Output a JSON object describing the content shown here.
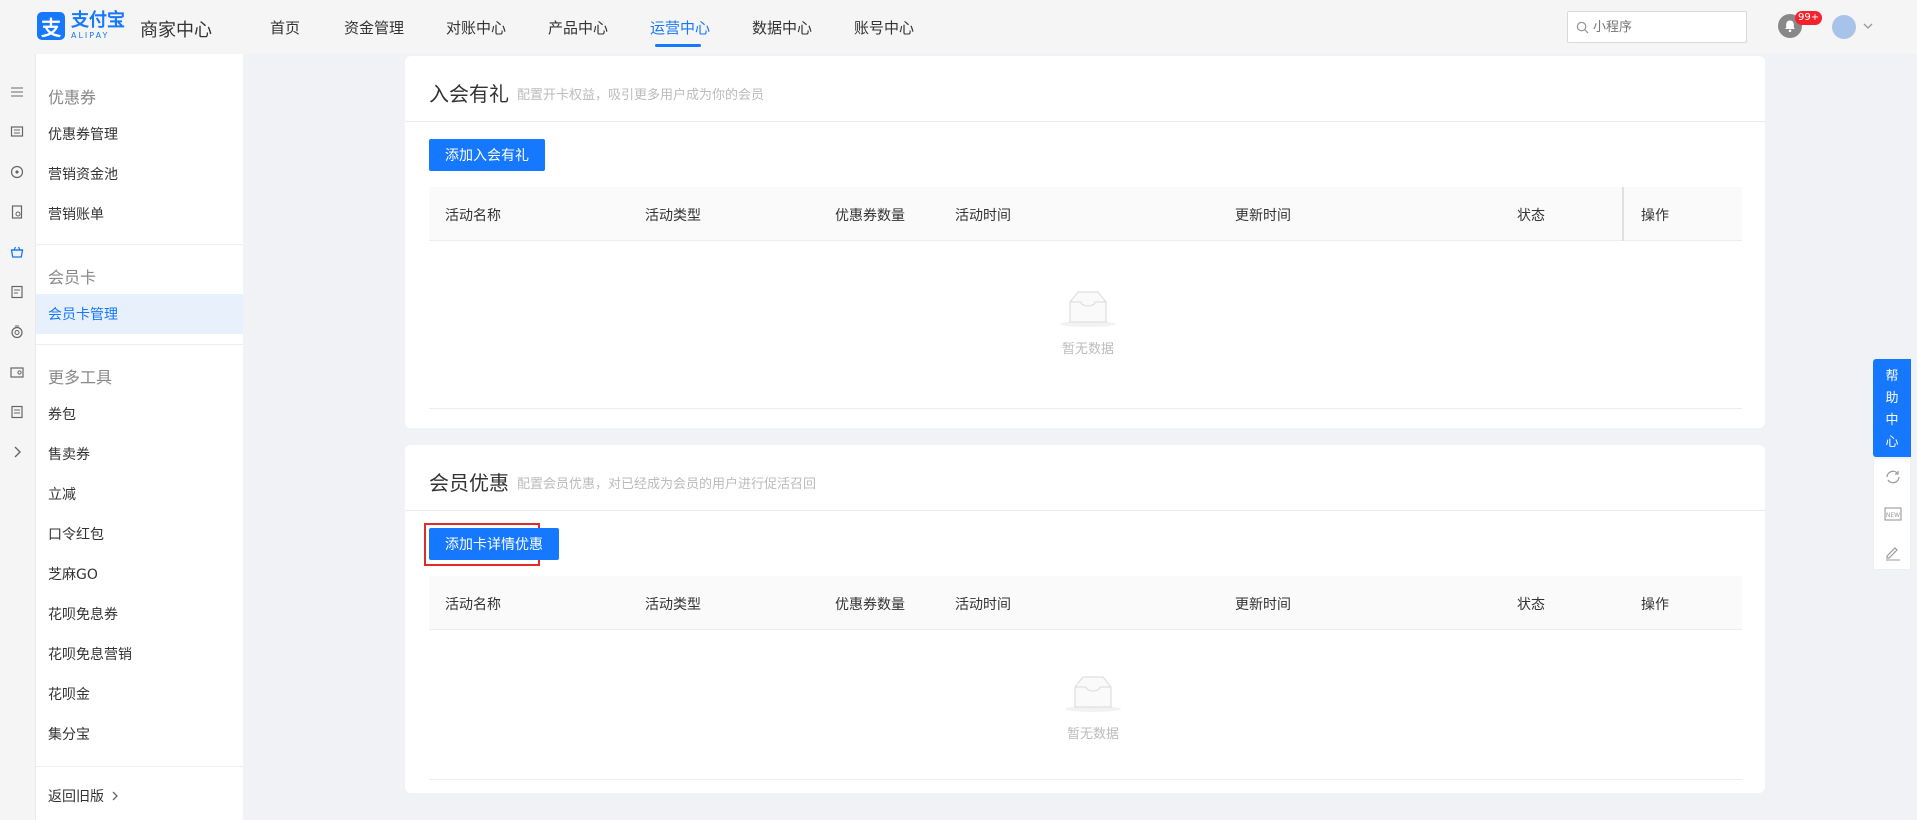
{
  "header": {
    "logo_cn": "支付宝",
    "logo_en": "ALIPAY",
    "logo_mark": "支",
    "brand": "商家中心",
    "nav": [
      {
        "label": "首页"
      },
      {
        "label": "资金管理"
      },
      {
        "label": "对账中心"
      },
      {
        "label": "产品中心"
      },
      {
        "label": "运营中心",
        "active": true
      },
      {
        "label": "数据中心"
      },
      {
        "label": "账号中心"
      }
    ],
    "search_placeholder": "小程序",
    "badge": "99+"
  },
  "sidebar": {
    "groups": [
      {
        "title": "优惠券",
        "items": [
          "优惠券管理",
          "营销资金池",
          "营销账单"
        ]
      },
      {
        "title": "会员卡",
        "items": [
          "会员卡管理"
        ]
      },
      {
        "title": "更多工具",
        "items": [
          "券包",
          "售卖券",
          "立减",
          "口令红包",
          "芝麻GO",
          "花呗免息券",
          "花呗免息营销",
          "花呗金",
          "集分宝"
        ]
      }
    ],
    "active_item": "会员卡管理",
    "back_label": "返回旧版"
  },
  "section1": {
    "title": "入会有礼",
    "desc": "配置开卡权益，吸引更多用户成为你的会员",
    "button": "添加入会有礼",
    "columns": [
      "活动名称",
      "活动类型",
      "优惠券数量",
      "活动时间",
      "更新时间",
      "状态",
      "操作"
    ],
    "empty": "暂无数据"
  },
  "section2": {
    "title": "会员优惠",
    "desc": "配置会员优惠，对已经成为会员的用户进行促活召回",
    "button": "添加卡详情优惠",
    "columns": [
      "活动名称",
      "活动类型",
      "优惠券数量",
      "活动时间",
      "更新时间",
      "状态",
      "操作"
    ],
    "empty": "暂无数据"
  },
  "help": {
    "chars": [
      "帮",
      "助",
      "中",
      "心"
    ]
  },
  "colors": {
    "primary": "#1677ff",
    "highlight": "#e02b2b",
    "badge": "#f5222d"
  }
}
